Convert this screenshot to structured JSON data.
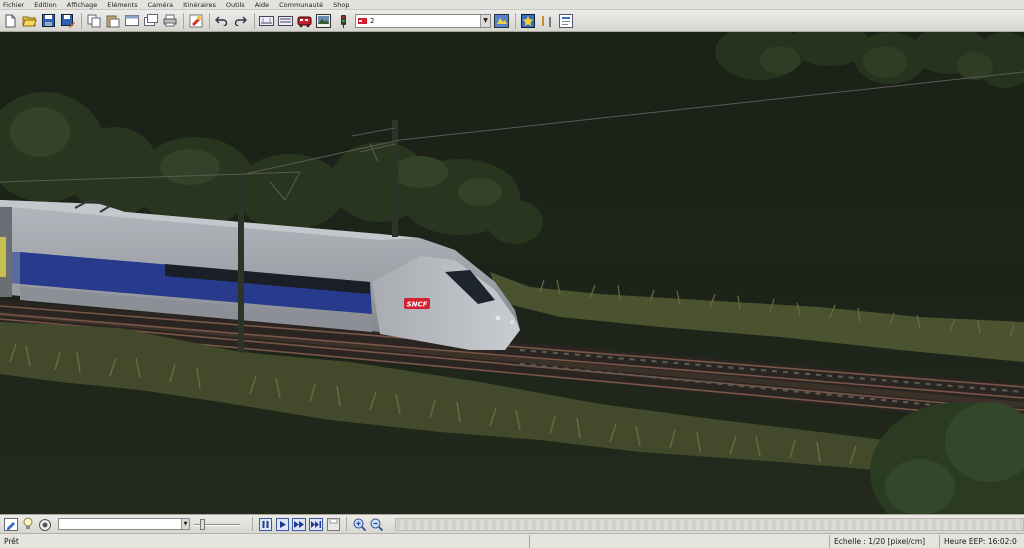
{
  "menu": {
    "items": [
      "Fichier",
      "Edition",
      "Affichage",
      "Eléments",
      "Caméra",
      "Itinéraires",
      "Outils",
      "Aide",
      "Communauté",
      "Shop"
    ]
  },
  "toolbar": {
    "layer_value": "2",
    "icons": [
      "new-icon",
      "open-icon",
      "save-icon",
      "save-as-icon",
      "copy-icon",
      "paste-icon",
      "window-icon",
      "window-icon-2",
      "print-icon",
      "paint-icon",
      "undo-icon",
      "redo-icon",
      "layout-icon",
      "layout-icon-2",
      "train-icon",
      "screenshot-icon",
      "signal-icon",
      "layer-settings-icon",
      "star-icon",
      "tools-icon",
      "info-icon"
    ]
  },
  "bottombar": {
    "icons": [
      "edit-mode-icon",
      "lightbulb-icon",
      "camera-icon",
      "pause-icon",
      "play-icon",
      "fast-forward-icon",
      "fast-forward-2-icon",
      "disk-icon",
      "zoom-in-icon",
      "zoom-out-icon"
    ],
    "speed_level": 0.15,
    "route_value": ""
  },
  "status": {
    "ready": "Prêt",
    "scale": "Echelle : 1/20 [pixel/cm]",
    "time": "Heure EEP: 16:02:0"
  },
  "train": {
    "logo": "SNCF"
  },
  "colors": {
    "toolbar_bg": "#e4e2dc",
    "sky": "#1e2418",
    "train_blue": "#283a8c",
    "sncf_red": "#d42030"
  }
}
